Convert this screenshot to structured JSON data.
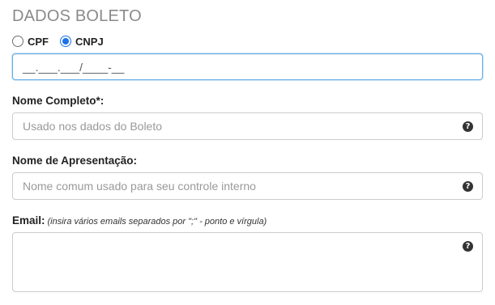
{
  "section": {
    "title": "DADOS BOLETO"
  },
  "doc_type": {
    "options": [
      {
        "label": "CPF",
        "checked": false
      },
      {
        "label": "CNPJ",
        "checked": true
      }
    ]
  },
  "cnpj_input": {
    "value": "__.___.___/____-__"
  },
  "nome_completo": {
    "label": "Nome Completo*:",
    "placeholder": "Usado nos dados do Boleto",
    "help_icon": "question-circle-icon"
  },
  "nome_apresentacao": {
    "label": "Nome de Apresentação:",
    "placeholder": "Nome comum usado para seu controle interno",
    "help_icon": "question-circle-icon"
  },
  "email": {
    "label": "Email:",
    "hint": "(insira vários emails separados por \";\" - ponto e vírgula)",
    "value": "",
    "help_icon": "question-circle-icon"
  },
  "colors": {
    "accent": "#1a73e8",
    "focus_border": "#66afe9",
    "title": "#8a8a8a"
  }
}
